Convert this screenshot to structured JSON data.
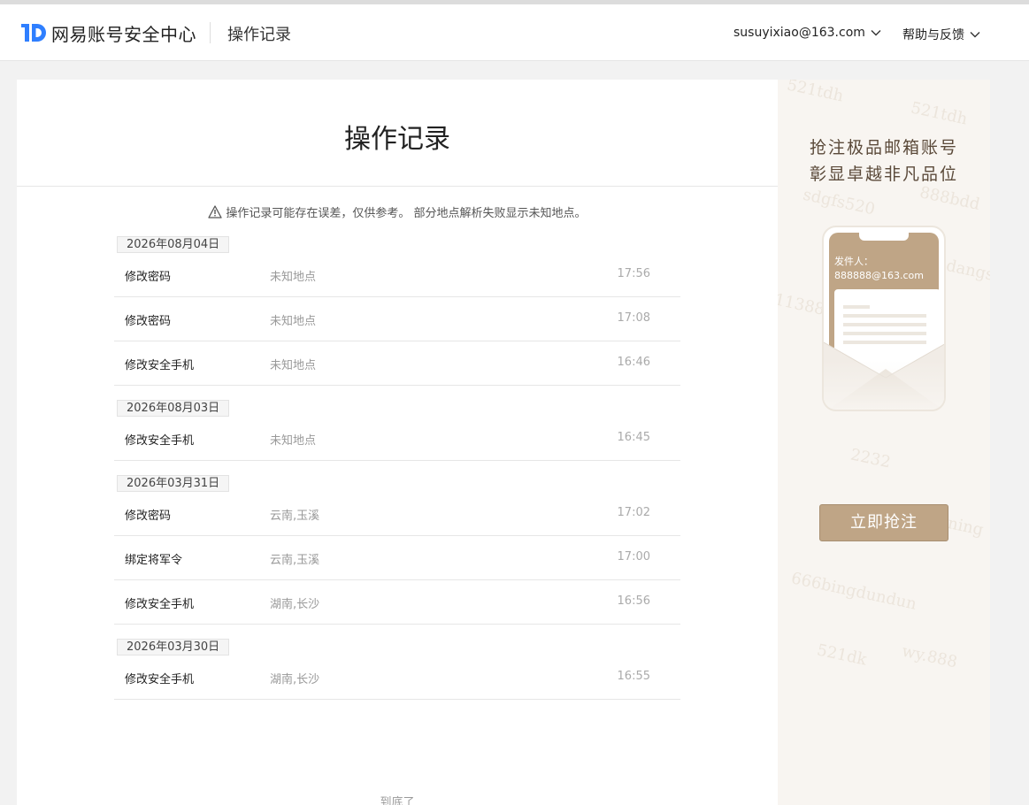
{
  "header": {
    "brand": "网易账号安全中心",
    "page_name": "操作记录",
    "user_email": "susuyixiao@163.com",
    "help_label": "帮助与反馈"
  },
  "colors": {
    "brand_blue": "#2f7fff",
    "ad_gold": "#bfa586"
  },
  "main": {
    "title": "操作记录",
    "notice": "操作记录可能存在误差，仅供参考。 部分地点解析失败显示未知地点。",
    "groups": [
      {
        "date": "2026年08月04日",
        "rows": [
          {
            "op": "修改密码",
            "loc": "未知地点",
            "time": "17:56"
          },
          {
            "op": "修改密码",
            "loc": "未知地点",
            "time": "17:08"
          },
          {
            "op": "修改安全手机",
            "loc": "未知地点",
            "time": "16:46"
          }
        ]
      },
      {
        "date": "2026年08月03日",
        "rows": [
          {
            "op": "修改安全手机",
            "loc": "未知地点",
            "time": "16:45"
          }
        ]
      },
      {
        "date": "2026年03月31日",
        "rows": [
          {
            "op": "修改密码",
            "loc": "云南,玉溪",
            "time": "17:02"
          },
          {
            "op": "绑定将军令",
            "loc": "云南,玉溪",
            "time": "17:00"
          },
          {
            "op": "修改安全手机",
            "loc": "湖南,长沙",
            "time": "16:56"
          }
        ]
      },
      {
        "date": "2026年03月30日",
        "rows": [
          {
            "op": "修改安全手机",
            "loc": "湖南,长沙",
            "time": "16:55"
          }
        ]
      }
    ],
    "bottom_text": "到底了"
  },
  "ad": {
    "line1": "抢注极品邮箱账号",
    "line2": "彰显卓越非凡品位",
    "sender_label": "发件人：",
    "sender_email": "888888@163.com",
    "button_label": "立即抢注",
    "watermarks": [
      "521tdh",
      "sdgfs520",
      "888bdd",
      "11388",
      "dangst",
      "2232",
      "ning",
      "666bingdundun",
      "521dk",
      "wy.888"
    ]
  }
}
